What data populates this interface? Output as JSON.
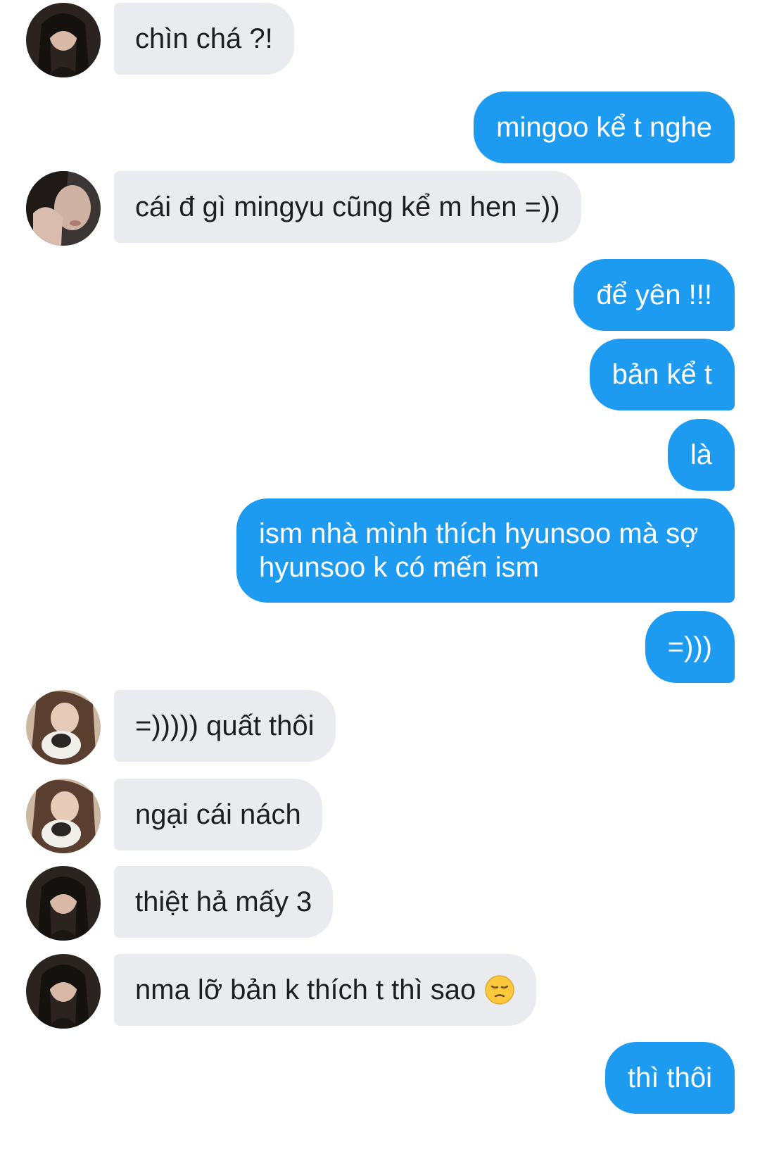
{
  "conversation": {
    "messages": [
      {
        "side": "in",
        "text": "chìn chá ?!"
      },
      {
        "side": "out",
        "text": "mingoo kể t nghe"
      },
      {
        "side": "in",
        "text": "cái đ gì mingyu cũng kể m hen =))"
      },
      {
        "side": "out",
        "text": "để yên !!!"
      },
      {
        "side": "out",
        "text": "bản kể t"
      },
      {
        "side": "out",
        "text": "là"
      },
      {
        "side": "out",
        "text": "ism nhà mình thích hyunsoo mà sợ hyunsoo k có mến ism"
      },
      {
        "side": "out",
        "text": "=)))"
      },
      {
        "side": "in",
        "text": "=))))) quất thôi"
      },
      {
        "side": "in",
        "text": "ngại cái nách"
      },
      {
        "side": "in",
        "text": "thiệt hả mấy 3"
      },
      {
        "side": "in",
        "text": "nma lỡ bản k thích t thì sao",
        "emoji": "pensive-face"
      },
      {
        "side": "out",
        "text": "thì thôi"
      }
    ]
  },
  "colors": {
    "outgoing_bubble": "#1d9bf0",
    "incoming_bubble": "#e9ebee",
    "incoming_text": "#1c1e21",
    "outgoing_text": "#ffffff"
  },
  "icons": {
    "avatars": [
      "avatar-dark-hair",
      "avatar-hand-on-face",
      "avatar-with-cat"
    ],
    "emoji": "pensive-face"
  }
}
